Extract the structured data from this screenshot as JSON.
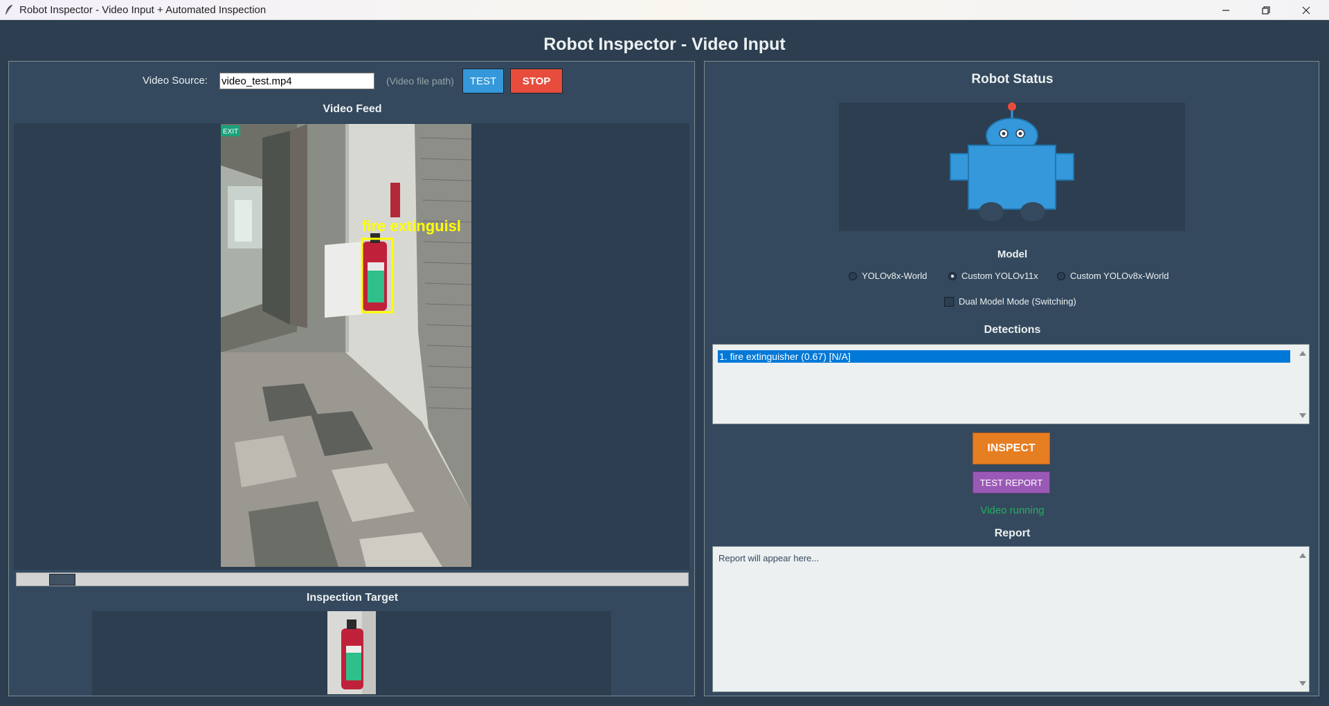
{
  "window": {
    "title": "Robot Inspector - Video Input + Automated Inspection"
  },
  "app": {
    "heading": "Robot Inspector - Video Input"
  },
  "left": {
    "source_label": "Video Source:",
    "source_value": "video_test.mp4",
    "source_hint": "(Video file path)",
    "test_label": "TEST",
    "stop_label": "STOP",
    "feed_title": "Video Feed",
    "detection_label": "fire extinguisl",
    "exit_sign": "EXIT",
    "slider_position": 0.05,
    "target_title": "Inspection Target"
  },
  "right": {
    "status_title": "Robot Status",
    "model_title": "Model",
    "models": [
      {
        "label": "YOLOv8x-World",
        "selected": false
      },
      {
        "label": "Custom YOLOv11x",
        "selected": true
      },
      {
        "label": "Custom YOLOv8x-World",
        "selected": false
      }
    ],
    "dual_mode_label": "Dual Model Mode (Switching)",
    "dual_mode_checked": false,
    "detections_title": "Detections",
    "detections": [
      "1. fire extinguisher (0.67) [N/A]"
    ],
    "inspect_label": "INSPECT",
    "test_report_label": "TEST REPORT",
    "status_text": "Video running",
    "report_title": "Report",
    "report_placeholder": "Report will appear here..."
  },
  "colors": {
    "background": "#2c3e50",
    "panel": "#34495e",
    "test_button": "#3498db",
    "stop_button": "#e74c3c",
    "inspect_button": "#e67e22",
    "report_button": "#9b59b6",
    "status_green": "#27ae60",
    "robot_blue": "#3498db",
    "detection_yellow": "#ffff00"
  },
  "icons": {
    "app": "feather-icon",
    "minimize": "minimize-icon",
    "maximize": "restore-icon",
    "close": "close-icon"
  }
}
